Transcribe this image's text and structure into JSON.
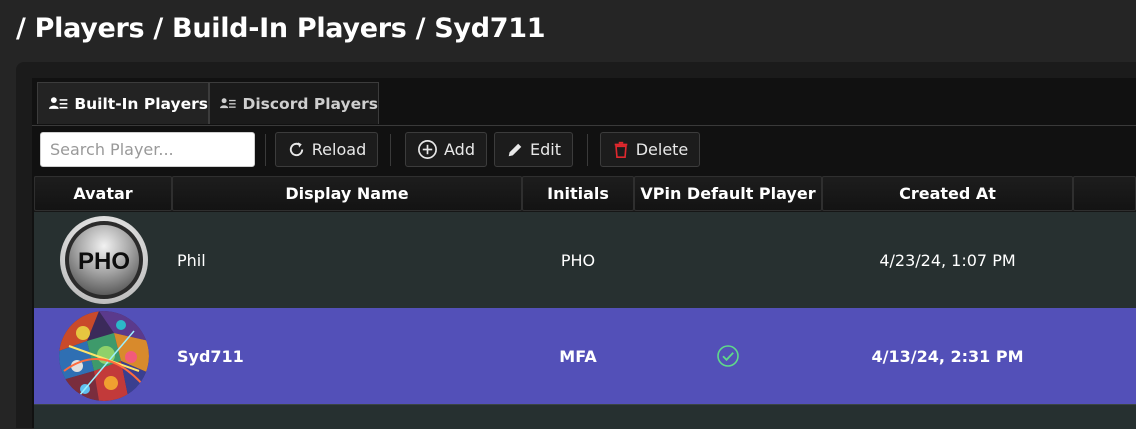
{
  "breadcrumb": "/ Players / Build-In Players / Syd711",
  "tabs": [
    {
      "label": "Built-In Players",
      "icon": "users-list-icon",
      "active": true
    },
    {
      "label": "Discord Players",
      "icon": "users-list-icon",
      "active": false
    }
  ],
  "toolbar": {
    "search_placeholder": "Search Player...",
    "reload_label": "Reload",
    "add_label": "Add",
    "edit_label": "Edit",
    "delete_label": "Delete"
  },
  "table": {
    "columns": [
      "Avatar",
      "Display Name",
      "Initials",
      "VPin Default Player",
      "Created At"
    ],
    "rows": [
      {
        "avatar_text": "PHO",
        "display_name": "Phil",
        "initials": "PHO",
        "default_player": false,
        "created_at": "4/23/24, 1:07 PM",
        "selected": false
      },
      {
        "avatar_text": "",
        "display_name": "Syd711",
        "initials": "MFA",
        "default_player": true,
        "created_at": "4/13/24, 2:31 PM",
        "selected": true
      }
    ]
  },
  "colors": {
    "selected_row": "#5350b8",
    "row_bg": "#273030",
    "check": "#5fd98a",
    "delete_icon": "#e0282e"
  }
}
